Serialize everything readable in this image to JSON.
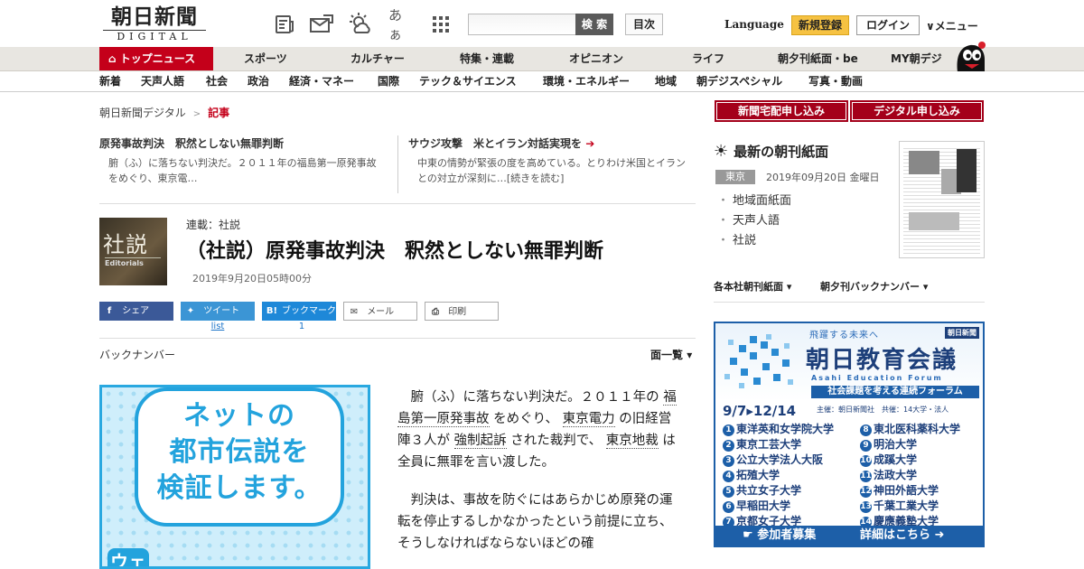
{
  "header": {
    "logo_main": "朝日新聞",
    "logo_sub": "DIGITAL",
    "icons": [
      "newspaper-icon",
      "mail-icon",
      "weather-icon",
      "font-size-icon",
      "grid-icon"
    ],
    "font_size_label": "あぁ",
    "search_placeholder": "",
    "search_label": "検 索",
    "toc_label": "目次",
    "language_label": "Language",
    "register_label": "新規登録",
    "login_label": "ログイン",
    "menu_label": "メニュー"
  },
  "nav_primary": {
    "items": [
      "トップニュース",
      "スポーツ",
      "カルチャー",
      "特集・連載",
      "オピニオン",
      "ライフ",
      "朝夕刊紙面・be",
      "MY朝デジ"
    ],
    "active_index": 0
  },
  "nav_secondary": {
    "items": [
      "新着",
      "天声人語",
      "社会",
      "政治",
      "経済・マネー",
      "国際",
      "テック＆サイエンス",
      "環境・エネルギー",
      "地域",
      "朝デジスペシャル",
      "写真・動画"
    ]
  },
  "breadcrumb": {
    "root": "朝日新聞デジタル",
    "separator": ">",
    "current": "記事"
  },
  "related": [
    {
      "title": "原発事故判決　釈然としない無罪判断",
      "summary": "腑（ふ）に落ちない判決だ。２０１１年の福島第一原発事故をめぐり、東京電…"
    },
    {
      "title": "サウジ攻撃　米とイラン対話実現を",
      "summary": "中東の情勢が緊張の度を高めている。とりわけ米国とイランとの対立が深刻に…[続きを読む]"
    }
  ],
  "article": {
    "thumb_kanji": "社説",
    "thumb_en": "Editorials",
    "series": "連載：社説",
    "headline": "（社説）原発事故判決　釈然としない無罪判断",
    "published": "2019年9月20日05時00分",
    "paragraphs": [
      [
        "腑（ふ）に落ちない判決だ。２０１１年の ",
        "福島第一原発事故",
        " をめぐり、 ",
        "東京電力",
        " の旧経営陣３人が ",
        "強制起訴",
        " された裁判で、 ",
        "東京地裁",
        " は全員に無罪を言い渡した。"
      ],
      [
        "判決は、事故を防ぐにはあらかじめ原発の運転を停止するしかなかったという前提に立ち、そうしなければならないほどの確"
      ]
    ]
  },
  "share": {
    "facebook": "シェア",
    "twitter": "ツイート",
    "twitter_count": "list",
    "hatena": "ブックマーク",
    "hatena_icon": "B!",
    "hatena_count": "1",
    "mail": "メール",
    "print": "印刷"
  },
  "backnumber": {
    "label": "バックナンバー",
    "list_label": "面一覧"
  },
  "ad_left": {
    "text_lines": [
      "ネットの",
      "都市伝説を",
      "検証します。"
    ],
    "corner": "ウェ"
  },
  "sidebar": {
    "subscribe_home": "新聞宅配申し込み",
    "subscribe_digital": "デジタル申し込み",
    "paper_heading": "最新の朝刊紙面",
    "edition": "東京",
    "edition_date": "2019年09月20日 金曜日",
    "paper_links": [
      "地域面紙面",
      "天声人語",
      "社説"
    ],
    "dropdown_1": "各本社朝刊紙面",
    "dropdown_2": "朝夕刊バックナンバー"
  },
  "ad_right": {
    "logo": "朝日新聞",
    "tagline": "飛躍する未来へ",
    "title": "朝日教育会議",
    "title_en": "Asahi Education Forum",
    "subtitle": "社会課題を考える連続フォーラム",
    "dates": "9/7▸12/14",
    "hosts": "主催：朝日新聞社　共催：14大学・法人",
    "universities": [
      "東洋英和女学院大学",
      "東北医科薬科大学",
      "東京工芸大学",
      "明治大学",
      "公立大学法人大阪",
      "成蹊大学",
      "拓殖大学",
      "法政大学",
      "共立女子大学",
      "神田外語大学",
      "早稲田大学",
      "千葉工業大学",
      "京都女子大学",
      "慶應義塾大学"
    ],
    "cta_left": "参加者募集",
    "cta_right": "詳細はこちら"
  },
  "colors": {
    "brand_red": "#c4001a",
    "register_yellow": "#f6c242",
    "facebook": "#3b5998",
    "twitter": "#3b95d5",
    "hatena": "#1e88d8",
    "ad_blue": "#1d5fa8"
  }
}
